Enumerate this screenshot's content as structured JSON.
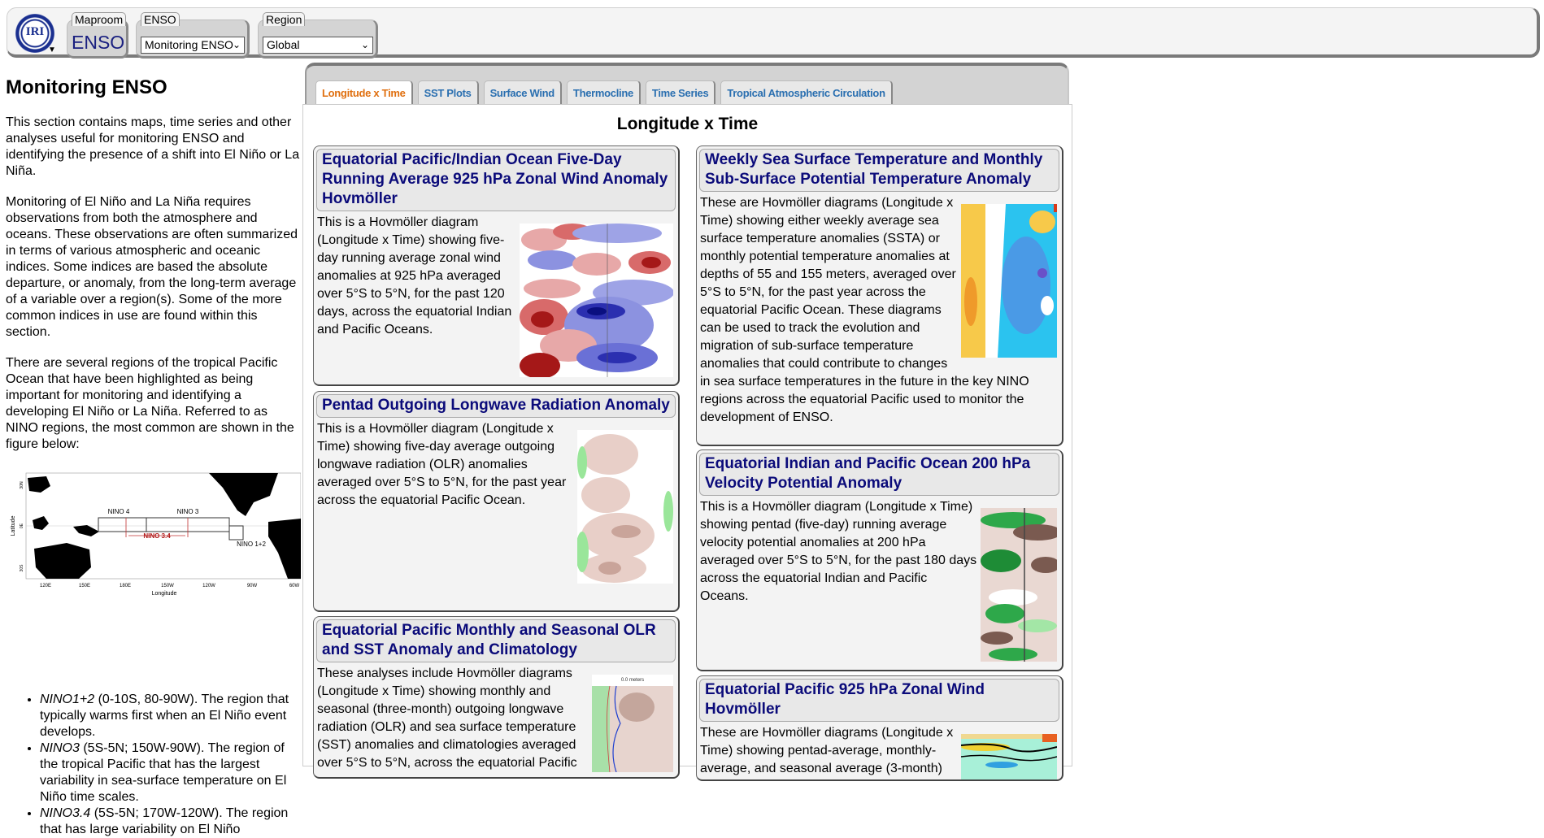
{
  "topbar": {
    "logo_text": "IRI",
    "logo_caret": "▼",
    "maproom_legend": "Maproom",
    "maproom_value": "ENSO",
    "enso_legend": "ENSO",
    "enso_selected": "Monitoring ENSO",
    "region_legend": "Region",
    "region_selected": "Global",
    "chevron": "⌄"
  },
  "left": {
    "title": "Monitoring ENSO",
    "para1": "This section contains maps, time series and other analyses useful for monitoring ENSO and identifying the presence of a shift into El Niño or La Niña.",
    "para2": "Monitoring of El Niño and La Niña requires observations from both the atmosphere and oceans. These observations are often summarized in terms of various atmospheric and oceanic indices. Some indices are based the absolute departure, or anomaly, from the long-term average of a variable over a region(s). Some of the more common indices in use are found within this section.",
    "para3": "There are several regions of the tropical Pacific Ocean that have been highlighted as being important for monitoring and identifying a developing El Niño or La Niña. Referred to as NINO regions, the most common are shown in the figure below:",
    "map": {
      "ylabel": "Latitude",
      "xlabel": "Longitude",
      "yticks": [
        "30N",
        "0E",
        "30S"
      ],
      "xticks": [
        "120E",
        "150E",
        "180E",
        "150W",
        "120W",
        "90W",
        "60W"
      ],
      "labels": {
        "nino4": "NINO 4",
        "nino3": "NINO 3",
        "nino34": "NINO 3.4",
        "nino12": "NINO 1+2"
      },
      "nino34_color": "#b01818"
    },
    "regions": [
      {
        "name": "NINO1+2",
        "desc": " (0-10S, 80-90W). The region that typically warms first when an El Niño event develops."
      },
      {
        "name": "NINO3",
        "desc": " (5S-5N; 150W-90W). The region of the tropical Pacific that has the largest variability in sea-surface temperature on El Niño time scales."
      },
      {
        "name": "NINO3.4",
        "desc": " (5S-5N; 170W-120W). The region that has large variability on El Niño"
      }
    ]
  },
  "tabs": [
    {
      "label": "Longitude x Time",
      "active": true
    },
    {
      "label": "SST Plots"
    },
    {
      "label": "Surface Wind"
    },
    {
      "label": "Thermocline"
    },
    {
      "label": "Time Series"
    },
    {
      "label": "Tropical Atmospheric Circulation"
    }
  ],
  "content": {
    "heading": "Longitude x Time",
    "cards": [
      {
        "title": "Equatorial Pacific/Indian Ocean Five-Day Running Average 925 hPa Zonal Wind Anomaly Hovmöller",
        "text": "This is a Hovmöller diagram (Longitude x Time) showing five-day running average zonal wind anomalies at 925 hPa averaged over 5°S to 5°N, for the past 120 days, across the equatorial Indian and Pacific Oceans.",
        "thumb": "red-blue-hovmoller"
      },
      {
        "title": "Weekly Sea Surface Temperature and Monthly Sub-Surface Potential Temperature Anomaly",
        "text": "These are Hovmöller diagrams (Longitude x Time) showing either weekly average sea surface temperature anomalies (SSTA) or monthly potential temperature anomalies at depths of 55 and 155 meters, averaged over 5°S to 5°N, for the past year across the equatorial Pacific Ocean. These diagrams can be used to track the evolution and migration of sub-surface temperature anomalies that could contribute to changes in sea surface temperatures in the future in the key NINO regions across the equatorial Pacific used to monitor the development of ENSO.",
        "thumb": "orange-cyan-hovmoller"
      },
      {
        "title": "Pentad Outgoing Longwave Radiation Anomaly",
        "text": "This is a Hovmöller diagram (Longitude x Time) showing five-day average outgoing longwave radiation (OLR) anomalies averaged over 5°S to 5°N, for the past year across the equatorial Pacific Ocean.",
        "thumb": "brown-green-olr"
      },
      {
        "title": "Equatorial Indian and Pacific Ocean 200 hPa Velocity Potential Anomaly",
        "text": "This is a Hovmöller diagram (Longitude x Time) showing pentad (five-day) running average velocity potential anomalies at 200 hPa averaged over 5°S to 5°N, for the past 180 days across the equatorial Indian and Pacific Oceans.",
        "thumb": "green-brown-velocity"
      },
      {
        "title": "Equatorial Pacific Monthly and Seasonal OLR and SST Anomaly and Climatology",
        "text": "These analyses include Hovmöller diagrams (Longitude x Time) showing monthly and seasonal (three-month) outgoing longwave radiation (OLR) and sea surface temperature (SST) anomalies and climatologies averaged over 5°S to 5°N, across the equatorial Pacific",
        "thumb_caption": "0.0 meters",
        "thumb": "olr-sst-climatology"
      },
      {
        "title": "Equatorial Pacific 925 hPa Zonal Wind Hovmöller",
        "text": "These are Hovmöller diagrams (Longitude x Time) showing pentad-average, monthly-average, and seasonal average (3-month)",
        "thumb": "zonal-wind-contour"
      }
    ]
  }
}
